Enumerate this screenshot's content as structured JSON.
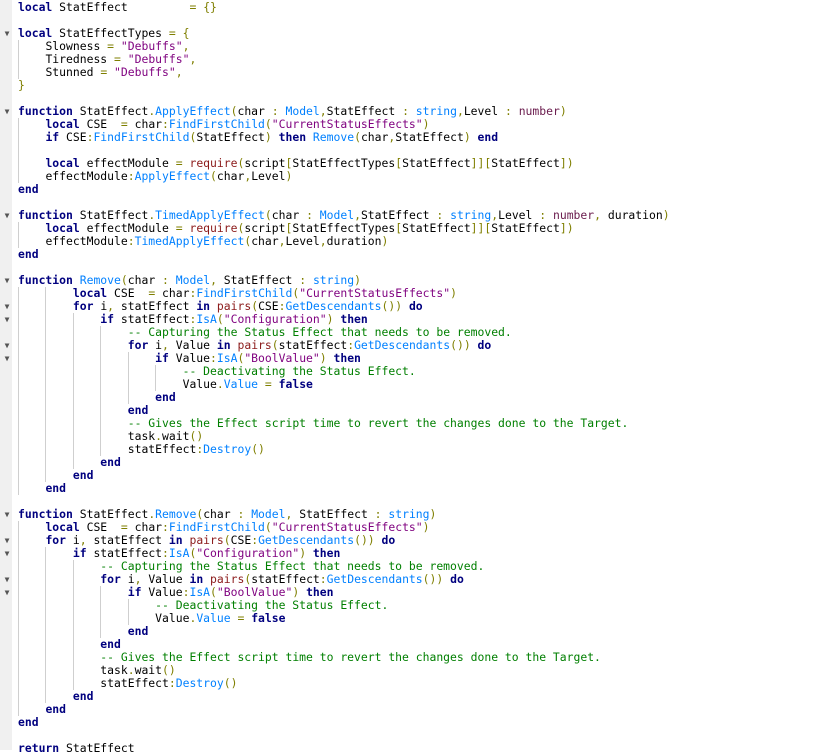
{
  "editor": {
    "language": "luau",
    "colors": {
      "keyword": "#00007f",
      "string": "#7f007f",
      "comment": "#007f00",
      "operator": "#7f7f00",
      "method": "#0080ff",
      "builtin": "#8b1a1a"
    },
    "fold_icon": "triangle-down-icon",
    "lines": [
      "local StatEffect         = {}",
      "",
      "local StatEffectTypes = {",
      "    Slowness = \"Debuffs\",",
      "    Tiredness = \"Debuffs\",",
      "    Stunned = \"Debuffs\",",
      "}",
      "",
      "function StatEffect.ApplyEffect(char : Model,StatEffect : string,Level : number)",
      "    local CSE  = char:FindFirstChild(\"CurrentStatusEffects\")",
      "    if CSE:FindFirstChild(StatEffect) then Remove(char,StatEffect) end",
      "    ",
      "    local effectModule = require(script[StatEffectTypes[StatEffect]][StatEffect])",
      "    effectModule:ApplyEffect(char,Level)",
      "end",
      "",
      "function StatEffect.TimedApplyEffect(char : Model,StatEffect : string,Level : number, duration)",
      "    local effectModule = require(script[StatEffectTypes[StatEffect]][StatEffect])",
      "    effectModule:TimedApplyEffect(char,Level,duration)",
      "end",
      "",
      "function Remove(char : Model, StatEffect : string)",
      "        local CSE  = char:FindFirstChild(\"CurrentStatusEffects\")",
      "        for i, statEffect in pairs(CSE:GetDescendants()) do",
      "            if statEffect:IsA(\"Configuration\") then",
      "                -- Capturing the Status Effect that needs to be removed.",
      "                for i, Value in pairs(statEffect:GetDescendants()) do",
      "                    if Value:IsA(\"BoolValue\") then",
      "                        -- Deactivating the Status Effect.",
      "                        Value.Value = false",
      "                    end",
      "                end",
      "                -- Gives the Effect script time to revert the changes done to the Target.",
      "                task.wait()",
      "                statEffect:Destroy()",
      "            end",
      "        end",
      "    end",
      "",
      "function StatEffect.Remove(char : Model, StatEffect : string)",
      "    local CSE  = char:FindFirstChild(\"CurrentStatusEffects\")",
      "    for i, statEffect in pairs(CSE:GetDescendants()) do",
      "        if statEffect:IsA(\"Configuration\") then",
      "            -- Capturing the Status Effect that needs to be removed.",
      "            for i, Value in pairs(statEffect:GetDescendants()) do",
      "                if Value:IsA(\"BoolValue\") then",
      "                    -- Deactivating the Status Effect.",
      "                    Value.Value = false",
      "                end",
      "            end",
      "            -- Gives the Effect script time to revert the changes done to the Target.",
      "            task.wait()",
      "            statEffect:Destroy()",
      "        end",
      "    end",
      "end",
      "",
      "return StatEffect"
    ]
  }
}
